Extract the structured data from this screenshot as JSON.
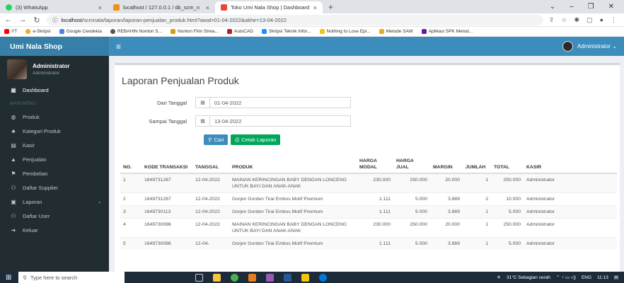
{
  "browser": {
    "tabs": [
      {
        "label": "(3) WhatsApp",
        "color": "#25d366",
        "active": false
      },
      {
        "label": "localhost / 127.0.0.1 / db_scm_n",
        "color": "#f29111",
        "active": false
      },
      {
        "label": "Toko Umi Nala Shop | Dashboard",
        "color": "#e8453c",
        "active": true
      }
    ],
    "new_tab": "+",
    "url_host": "localhost",
    "url_path": "/scmnala/laporan/laporan-penjualan_produk.html?awal=01-04-2022&akhir=13-04-2022",
    "bookmarks": [
      {
        "label": "YT",
        "color": "#ff0000"
      },
      {
        "label": "e-Skripsi",
        "color": "#f5a623"
      },
      {
        "label": "Google Cendekia",
        "color": "#4285f4"
      },
      {
        "label": "REBAHIN Nonton S...",
        "color": "#555555"
      },
      {
        "label": "Nonton Film Strea...",
        "color": "#d4a017"
      },
      {
        "label": "AutoCAD",
        "color": "#b22222"
      },
      {
        "label": "Skripsi Teknik Infor...",
        "color": "#1e90ff"
      },
      {
        "label": "Nothing to Lose Epi...",
        "color": "#f0c419"
      },
      {
        "label": "Metode SAW",
        "color": "#f5a623"
      },
      {
        "label": "Aplikasi SPK Metod...",
        "color": "#6a1b9a"
      }
    ]
  },
  "sidebar": {
    "brand": "Umi Nala Shop",
    "user_name": "Administrator",
    "user_role": "Administrator",
    "items": [
      {
        "label": "Dashboard",
        "icon": "grid-icon",
        "glyph": "▦",
        "active": true
      },
      {
        "label": "MAIN MENU",
        "header": true
      },
      {
        "label": "Produk",
        "icon": "produk-icon",
        "glyph": "◍"
      },
      {
        "label": "Kategori Produk",
        "icon": "kategori-icon",
        "glyph": "♣"
      },
      {
        "label": "Kasir",
        "icon": "kasir-icon",
        "glyph": "▤"
      },
      {
        "label": "Penjualan",
        "icon": "penjualan-icon",
        "glyph": "▲"
      },
      {
        "label": "Pembelian",
        "icon": "pembelian-icon",
        "glyph": "⚑"
      },
      {
        "label": "Daftar Supplier",
        "icon": "supplier-icon",
        "glyph": "⚇"
      },
      {
        "label": "Laporan",
        "icon": "laporan-icon",
        "glyph": "▣",
        "chevron": "‹"
      },
      {
        "label": "Daftar User",
        "icon": "user-icon",
        "glyph": "⚇"
      },
      {
        "label": "Keluar",
        "icon": "logout-icon",
        "glyph": "➜"
      }
    ]
  },
  "topnav": {
    "admin_label": "Administrator ⌄"
  },
  "page": {
    "title": "Laporan Penjualan Produk",
    "dari_label": "Dari Tanggal",
    "dari_value": "01-04-2022",
    "sampai_label": "Sampai Tanggal",
    "sampai_value": "13-04-2022",
    "cari_label": "Cari",
    "cetak_label": "Cetak Laporan"
  },
  "table": {
    "headers": [
      "NO.",
      "KODE TRANSAKSI",
      "TANGGAL",
      "PRODUK",
      "HARGA MODAL",
      "HARGA JUAL",
      "MARGIN",
      "JUMLAH",
      "TOTAL",
      "KASIR"
    ],
    "rows": [
      [
        "1",
        "1649731267",
        "12-04-2022",
        "MAINAN KERINCINGAN BABY DENGAN LONCENG UNTUK BAYI DAN ANAK-ANAK",
        "230.000",
        "250.000",
        "20.000",
        "1",
        "250.000",
        "Administrator"
      ],
      [
        "2",
        "1649731267",
        "12-04-2022",
        "Gorjen Gorden Tirai Embos Motif Premium",
        "1.111",
        "5.000",
        "3.889",
        "2",
        "10.000",
        "Administrator"
      ],
      [
        "3",
        "1649730113",
        "12-04-2022",
        "Gorjen Gorden Tirai Embos Motif Premium",
        "1.111",
        "5.000",
        "3.889",
        "1",
        "5.000",
        "Administrator"
      ],
      [
        "4",
        "1649730086",
        "12-04-2022",
        "MAINAN KERINCINGAN BABY DENGAN LONCENG UNTUK BAYI DAN ANAK-ANAK",
        "230.000",
        "250.000",
        "20.000",
        "1",
        "250.000",
        "Administrator"
      ],
      [
        "5",
        "1649730086",
        "12-04-",
        "Gorjen Gorden Tirai Embos Motif Premium",
        "1.111",
        "5.000",
        "3.889",
        "1",
        "5.000",
        "Administrator"
      ]
    ]
  },
  "taskbar": {
    "search_placeholder": "Type here to search",
    "weather": "31°C  Sebagian cerah",
    "lang": "ENG",
    "time": "11:13"
  }
}
